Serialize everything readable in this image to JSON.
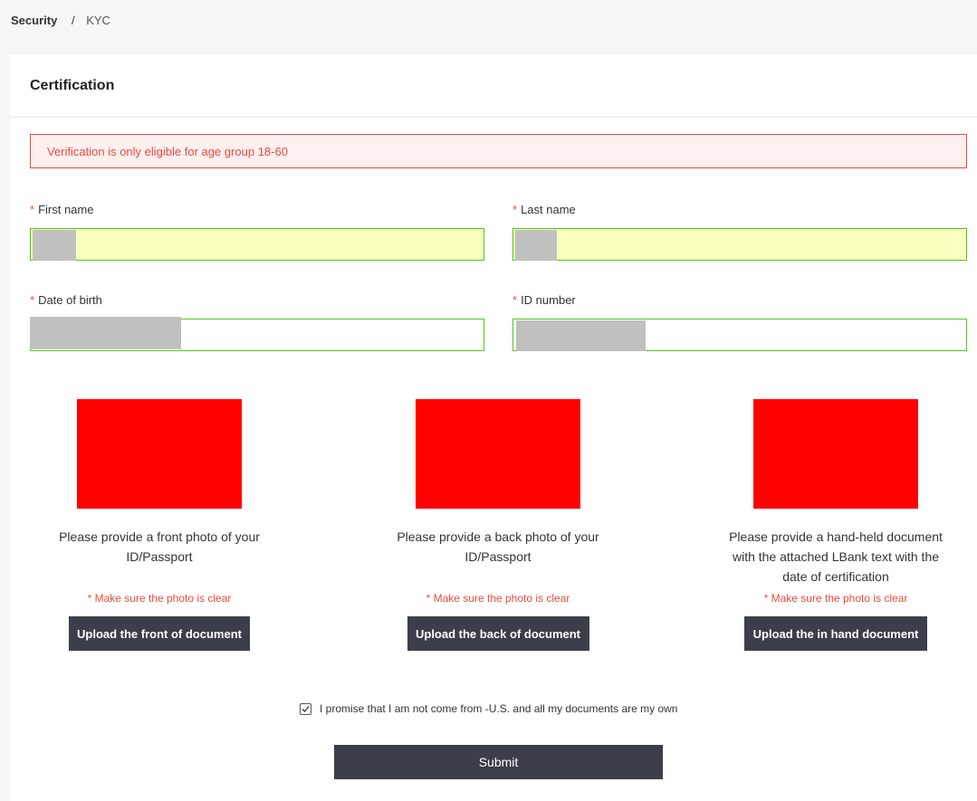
{
  "breadcrumb": {
    "parent": "Security",
    "separator": "/",
    "current": "KYC"
  },
  "card": {
    "title": "Certification"
  },
  "alert": {
    "text": "Verification is only eligible for age group 18-60"
  },
  "form": {
    "required_mark": "*",
    "first_name": {
      "label": "First name",
      "value": ""
    },
    "last_name": {
      "label": "Last name",
      "value": ""
    },
    "date_of_birth": {
      "label": "Date of birth",
      "value": ""
    },
    "id_number": {
      "label": "ID number",
      "value": ""
    }
  },
  "uploads": [
    {
      "description": "Please provide a front photo of your ID/Passport",
      "hint": "* Make sure the photo is clear",
      "button": "Upload the front of document"
    },
    {
      "description": "Please provide a back photo of your ID/Passport",
      "hint": "* Make sure the photo is clear",
      "button": "Upload the back of document"
    },
    {
      "description": "Please provide a hand-held document with the attached LBank text with the date of certification",
      "hint": "* Make sure the photo is clear",
      "button": "Upload the in hand document"
    }
  ],
  "agreement": {
    "text": "I promise that I am not come from -U.S. and all my documents are my own",
    "checked": true
  },
  "submit": {
    "label": "Submit"
  },
  "colors": {
    "accent_dark": "#3d3e4b",
    "error": "#e74c3c",
    "valid_border": "#52c41a",
    "autofill": "#faffbd"
  },
  "icons": {
    "checkbox": "check-icon"
  }
}
